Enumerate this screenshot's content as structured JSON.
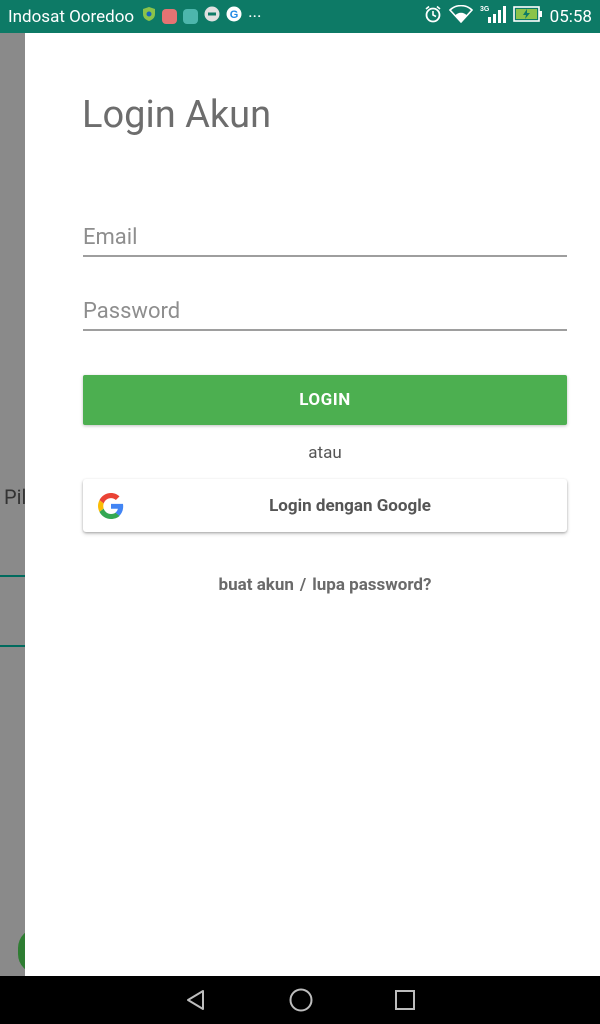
{
  "status_bar": {
    "carrier": "Indosat Ooredoo",
    "time": "05:58",
    "network_type": "3G",
    "more_indicator": "···",
    "background_color": "#0d7a66"
  },
  "background": {
    "partial_text": "Pil"
  },
  "login": {
    "title": "Login Akun",
    "email_placeholder": "Email",
    "password_placeholder": "Password",
    "login_button_label": "LOGIN",
    "separator_text": "atau",
    "google_button_label": "Login dengan Google",
    "create_account_link": "buat akun",
    "link_separator": "/",
    "forgot_password_link": "lupa password?",
    "accent_color": "#4caf50"
  },
  "nav_bar": {
    "back_icon": "back-triangle-icon",
    "home_icon": "home-circle-icon",
    "recents_icon": "recents-square-icon"
  }
}
